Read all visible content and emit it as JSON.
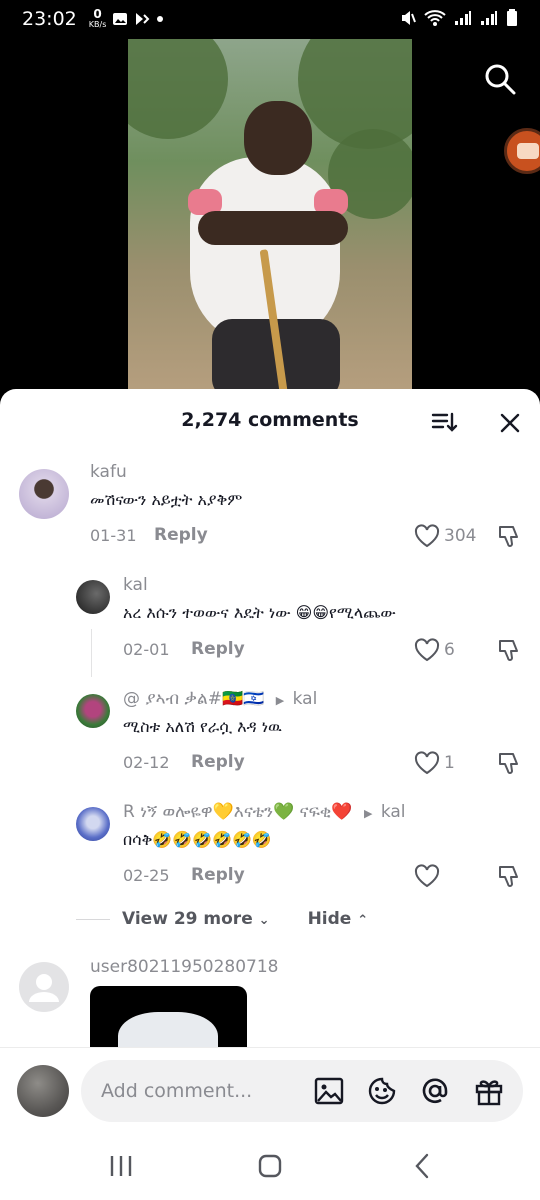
{
  "status_bar": {
    "time": "23:02",
    "kbs_value": "0",
    "kbs_unit": "KB/s"
  },
  "sheet": {
    "title": "2,274 comments"
  },
  "comments": [
    {
      "username": "kafu",
      "text": "መሽናውን አይቷት አያቅም",
      "date": "01-31",
      "reply_label": "Reply",
      "likes": "304"
    },
    {
      "username": "kal",
      "text": "አረ እሱን ተወውና እዴት ነው 😁😁የሚላጨው",
      "date": "02-01",
      "reply_label": "Reply",
      "likes": "6"
    },
    {
      "username": "@ ያኣብ ቃል#🇪🇹🇮🇱",
      "reply_to": "kal",
      "text": "ሚስቱ አለሽ የራሷ እዳ ነዉ",
      "date": "02-12",
      "reply_label": "Reply",
      "likes": "1"
    },
    {
      "username": "R ነኝ ወሎዬዋ💛እናቴን💚 ናፍቂ❤️",
      "reply_to": "kal",
      "text": "በሳቅ🤣🤣🤣🤣🤣🤣",
      "date": "02-25",
      "reply_label": "Reply",
      "likes": ""
    },
    {
      "username": "user80211950280718"
    }
  ],
  "view_more": {
    "label": "View 29 more",
    "hide_label": "Hide"
  },
  "input_bar": {
    "placeholder": "Add comment..."
  },
  "icons": {
    "search": "search-icon",
    "sort": "sort-icon",
    "close": "close-icon",
    "heart": "heart-icon",
    "dislike": "dislike-icon",
    "image": "image-icon",
    "emoji": "emoji-icon",
    "mention": "at-icon",
    "gift": "gift-icon"
  },
  "colors": {
    "text_primary": "#161823",
    "text_secondary": "#8a8b91",
    "sheet_bg": "#ffffff",
    "input_bg": "#f1f1f2"
  }
}
